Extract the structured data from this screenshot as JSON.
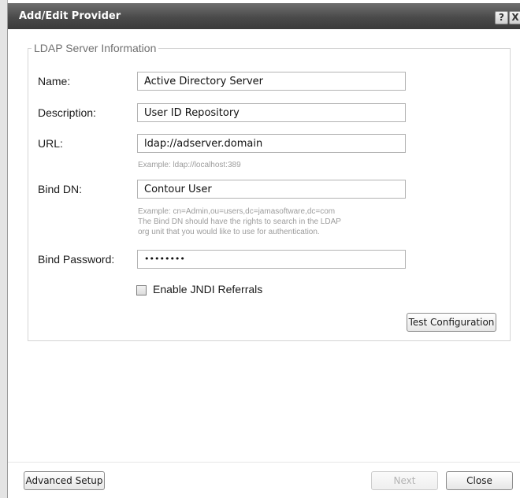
{
  "dialog": {
    "title": "Add/Edit Provider",
    "help_glyph": "?",
    "close_glyph": "X"
  },
  "group": {
    "legend": "LDAP Server Information"
  },
  "fields": {
    "name": {
      "label": "Name:",
      "value": "Active Directory Server"
    },
    "description": {
      "label": "Description:",
      "value": "User ID Repository"
    },
    "url": {
      "label": "URL:",
      "value": "ldap://adserver.domain",
      "hint": "Example: ldap://localhost:389"
    },
    "bind_dn": {
      "label": "Bind DN:",
      "value": "Contour User",
      "hint_lines": [
        "Example: cn=Admin,ou=users,dc=jamasoftware,dc=com",
        "The Bind DN should have the rights to search in the LDAP",
        "org unit that you would like to use for authentication."
      ]
    },
    "bind_password": {
      "label": "Bind Password:",
      "value": "••••••••"
    }
  },
  "jndi": {
    "label": "Enable JNDI Referrals",
    "checked": false
  },
  "buttons": {
    "test": "Test Configuration",
    "advanced": "Advanced Setup",
    "next": "Next",
    "close": "Close"
  },
  "colors": {
    "titlebar": "#4a4a4a",
    "title_text": "#ffffff",
    "hint_text": "#9c9c9c",
    "disabled_text": "#b3b3b3"
  }
}
